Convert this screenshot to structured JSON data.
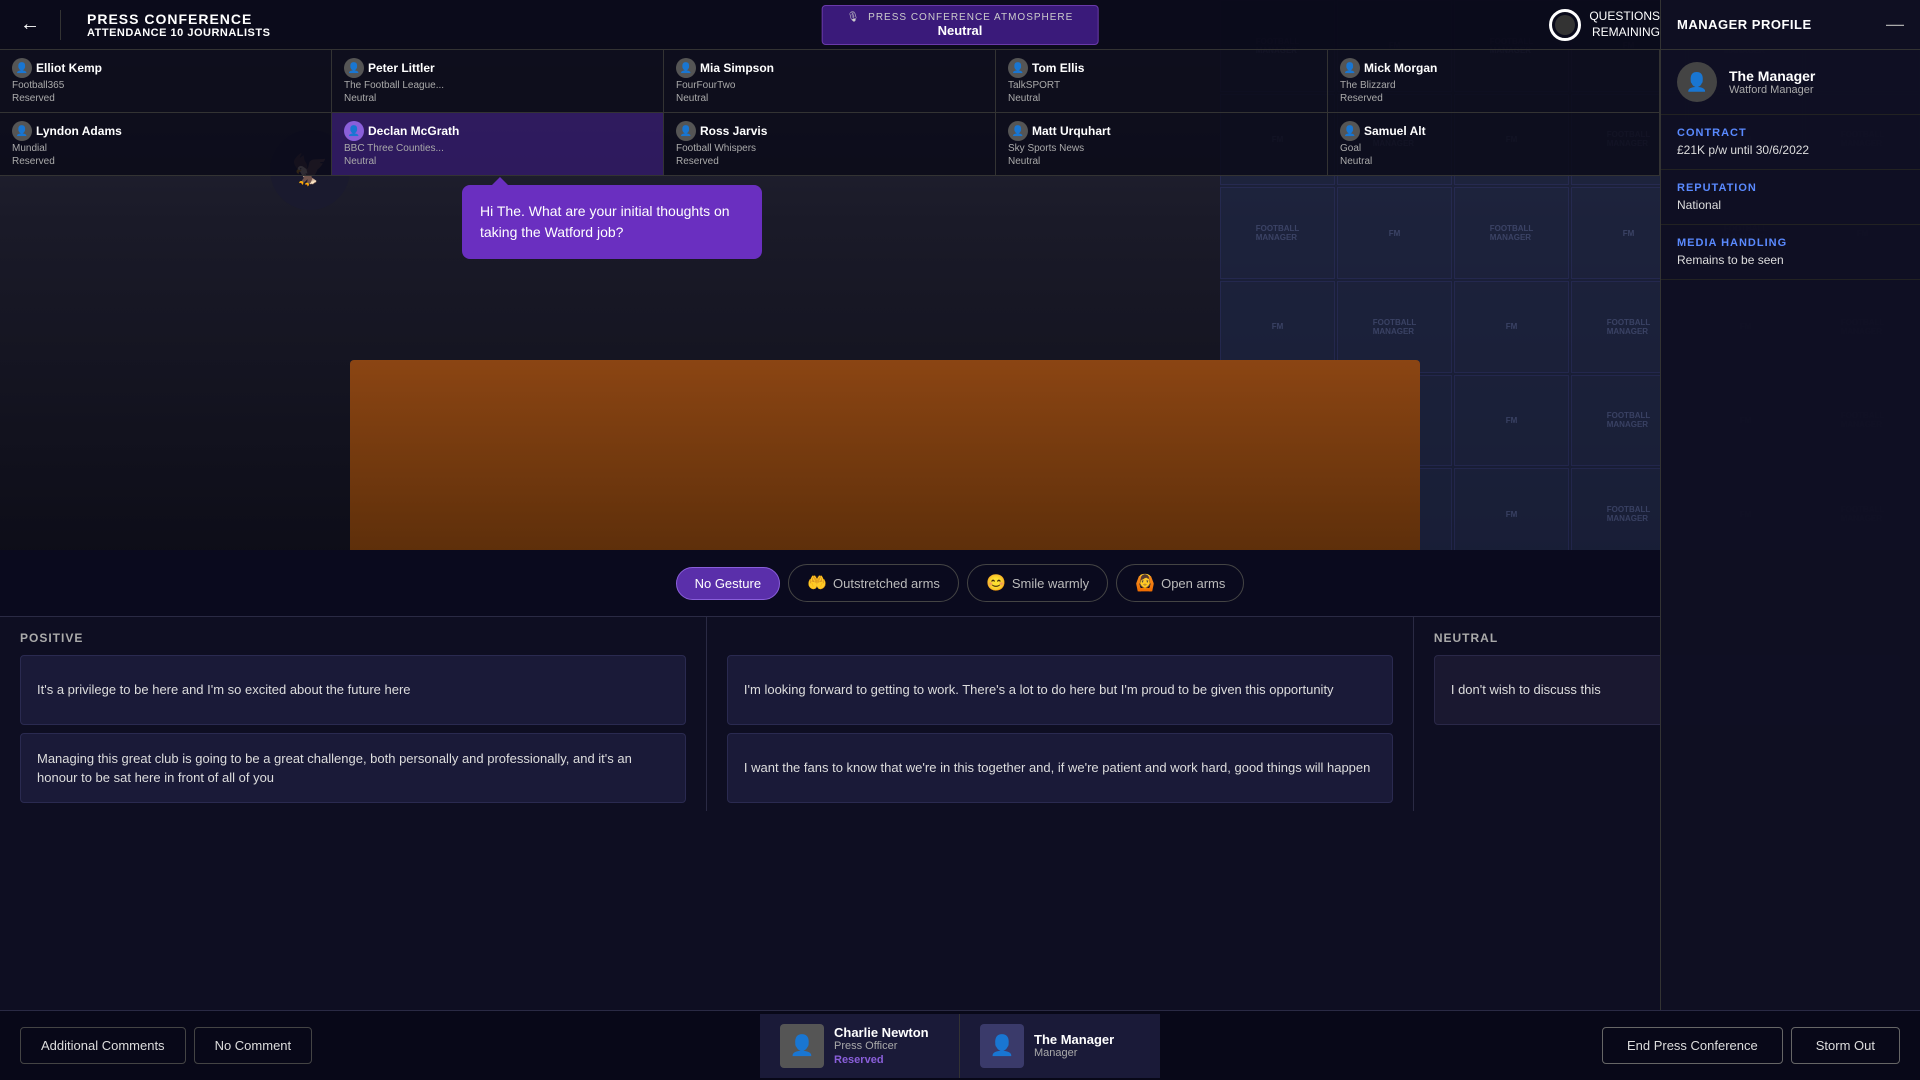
{
  "header": {
    "back_label": "←",
    "title": "PRESS CONFERENCE",
    "attendance_label": "ATTENDANCE",
    "journalists_count": "10 JOURNALISTS",
    "atmosphere_label": "PRESS CONFERENCE ATMOSPHERE",
    "atmosphere_icon": "🎙",
    "atmosphere_value": "Neutral",
    "questions_label": "QUESTIONS\nREMAINING",
    "profile_title": "MANAGER PROFILE",
    "profile_close": "—"
  },
  "manager_profile": {
    "name": "The Manager",
    "role": "Watford Manager",
    "contract_label": "CONTRACT",
    "contract_value": "£21K p/w until 30/6/2022",
    "reputation_label": "REPUTATION",
    "reputation_value": "National",
    "media_label": "MEDIA HANDLING",
    "media_value": "Remains to be seen"
  },
  "journalists": [
    {
      "name": "Elliot Kemp",
      "outlet": "Football365",
      "status": "Reserved",
      "attitude": ""
    },
    {
      "name": "Peter Littler",
      "outlet": "The Football League...",
      "status": "Neutral",
      "attitude": ""
    },
    {
      "name": "Mia Simpson",
      "outlet": "FourFourTwo",
      "status": "Neutral",
      "attitude": ""
    },
    {
      "name": "Tom Ellis",
      "outlet": "TalkSPORT",
      "status": "Neutral",
      "attitude": ""
    },
    {
      "name": "Mick Morgan",
      "outlet": "The Blizzard",
      "status": "Reserved",
      "attitude": ""
    }
  ],
  "journalists_row2": [
    {
      "name": "Lyndon Adams",
      "outlet": "Mundial",
      "status": "Reserved",
      "attitude": ""
    },
    {
      "name": "Declan McGrath",
      "outlet": "BBC Three Counties...",
      "status": "Neutral",
      "attitude": "",
      "active": true
    },
    {
      "name": "Ross Jarvis",
      "outlet": "Football Whispers",
      "status": "Reserved",
      "attitude": ""
    },
    {
      "name": "Matt Urquhart",
      "outlet": "Sky Sports News",
      "status": "Neutral",
      "attitude": ""
    },
    {
      "name": "Samuel Alt",
      "outlet": "Goal",
      "status": "Neutral",
      "attitude": ""
    }
  ],
  "question": {
    "text": "Hi The. What are your initial thoughts on taking the Watford job?"
  },
  "gestures": [
    {
      "id": "no-gesture",
      "label": "No Gesture",
      "icon": "",
      "active": true
    },
    {
      "id": "outstretched-arms",
      "label": "Outstretched arms",
      "icon": "🤲",
      "active": false
    },
    {
      "id": "smile-warmly",
      "label": "Smile warmly",
      "icon": "😊",
      "active": false
    },
    {
      "id": "open-arms",
      "label": "Open arms",
      "icon": "🙆",
      "active": false
    }
  ],
  "positive_label": "POSITIVE",
  "neutral_label": "NEUTRAL",
  "responses": {
    "positive": [
      "It's a privilege to be here and I'm so excited about the future here",
      "Managing this great club is going to be a great challenge, both personally and professionally, and it's an honour to be sat here in front of all of you"
    ],
    "positive_right": [
      "I'm looking forward to getting to work. There's a lot to do here but I'm proud to be given this opportunity",
      "I want the fans to know that we're in this together and, if we're patient and work hard, good things will happen"
    ],
    "neutral": [
      "I don't wish to discuss this"
    ]
  },
  "action_bar": {
    "additional_comments": "Additional Comments",
    "no_comment": "No Comment",
    "press_officer_name": "Charlie Newton",
    "press_officer_role": "Press Officer",
    "press_officer_status": "Reserved",
    "manager_name": "The Manager",
    "manager_role": "Manager",
    "end_conference": "End Press Conference",
    "storm_out": "Storm Out"
  },
  "logo_wall": {
    "text": "FOOTBALL MANAGER"
  }
}
